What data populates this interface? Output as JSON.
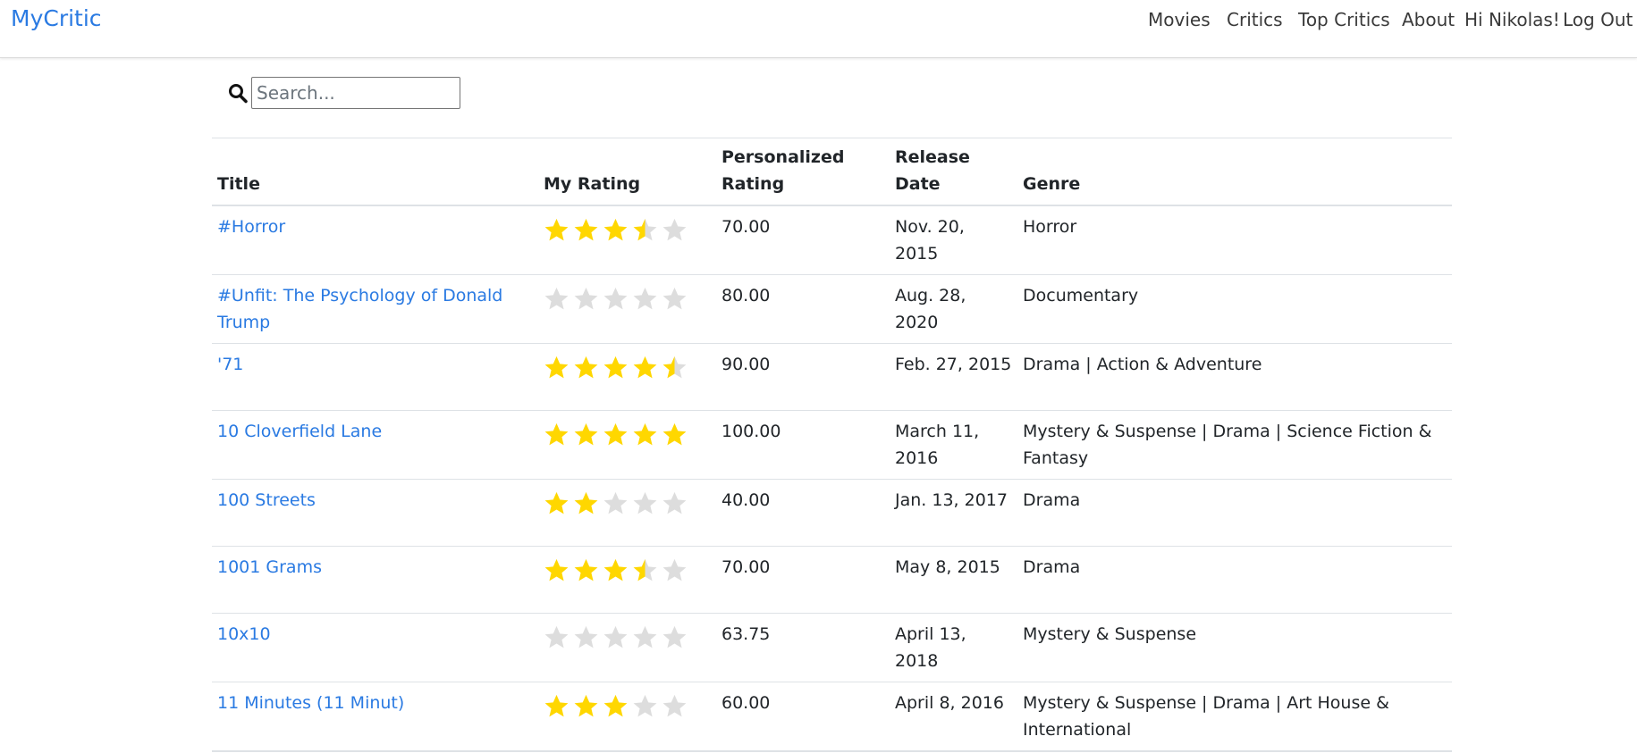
{
  "nav": {
    "brand": "MyCritic",
    "items": [
      "Movies",
      "Critics",
      "Top Critics",
      "About",
      "Hi Nikolas!",
      "Log Out"
    ]
  },
  "search": {
    "placeholder": "Search..."
  },
  "colors": {
    "accent": "#2a7ae2",
    "star_on": "#FFD700",
    "star_off": "#DDDDDD"
  },
  "table": {
    "headers": {
      "title": "Title",
      "my_rating": "My Rating",
      "personalized_line1": "Personalized",
      "personalized_line2": "Rating",
      "release_date": "Release Date",
      "genre": "Genre"
    },
    "rows": [
      {
        "title": "#Horror",
        "my_rating": 3.5,
        "personalized": "70.00",
        "release_date": "Nov. 20, 2015",
        "genre": "Horror"
      },
      {
        "title": "#Unfit: The Psychology of Donald Trump",
        "my_rating": 0,
        "personalized": "80.00",
        "release_date": "Aug. 28, 2020",
        "genre": "Documentary"
      },
      {
        "title": "'71",
        "my_rating": 4.5,
        "personalized": "90.00",
        "release_date": "Feb. 27, 2015",
        "genre": "Drama | Action & Adventure"
      },
      {
        "title": "10 Cloverfield Lane",
        "my_rating": 5,
        "personalized": "100.00",
        "release_date": "March 11, 2016",
        "genre": "Mystery & Suspense | Drama | Science Fiction & Fantasy"
      },
      {
        "title": "100 Streets",
        "my_rating": 2,
        "personalized": "40.00",
        "release_date": "Jan. 13, 2017",
        "genre": "Drama"
      },
      {
        "title": "1001 Grams",
        "my_rating": 3.5,
        "personalized": "70.00",
        "release_date": "May 8, 2015",
        "genre": "Drama"
      },
      {
        "title": "10x10",
        "my_rating": 0,
        "personalized": "63.75",
        "release_date": "April 13, 2018",
        "genre": "Mystery & Suspense"
      },
      {
        "title": "11 Minutes (11 Minut)",
        "my_rating": 3,
        "personalized": "60.00",
        "release_date": "April 8, 2016",
        "genre": "Mystery & Suspense | Drama | Art House & International"
      }
    ]
  }
}
